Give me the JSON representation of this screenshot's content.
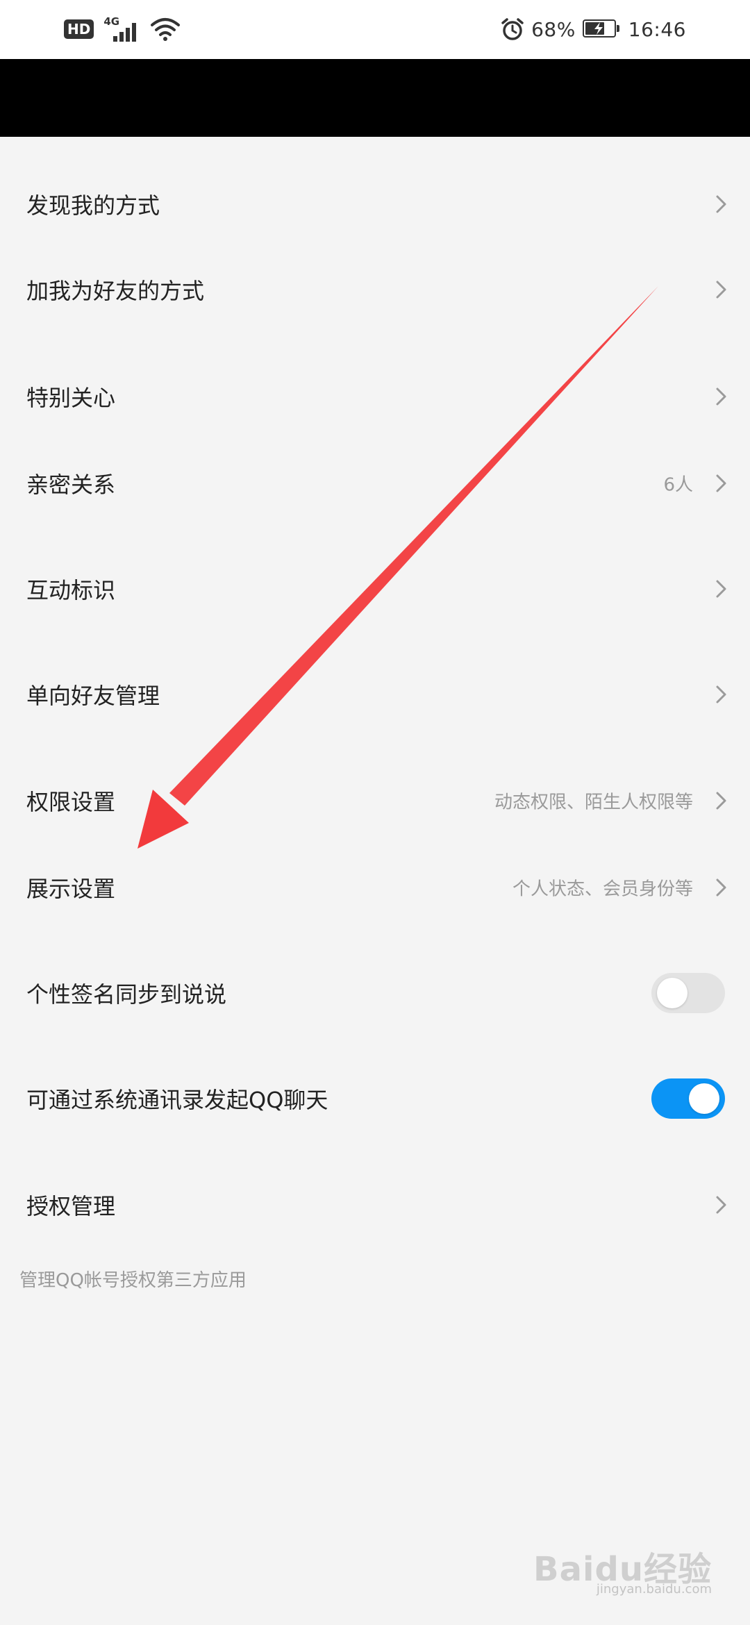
{
  "status_bar": {
    "hd": "HD",
    "network": "4G",
    "battery_percent": "68%",
    "time": "16:46",
    "battery_level": 0.68,
    "icons": [
      "signal-icon",
      "wifi-icon",
      "alarm-icon",
      "battery-charging-icon"
    ]
  },
  "settings": {
    "items": [
      {
        "label": "发现我的方式",
        "value": ""
      },
      {
        "label": "加我为好友的方式",
        "value": ""
      },
      {
        "label": "特别关心",
        "value": ""
      },
      {
        "label": "亲密关系",
        "value": "6人"
      },
      {
        "label": "互动标识",
        "value": ""
      },
      {
        "label": "单向好友管理",
        "value": ""
      },
      {
        "label": "权限设置",
        "value": "动态权限、陌生人权限等"
      },
      {
        "label": "展示设置",
        "value": "个人状态、会员身份等"
      },
      {
        "label": "个性签名同步到说说",
        "toggle": "off"
      },
      {
        "label": "可通过系统通讯录发起QQ聊天",
        "toggle": "on"
      },
      {
        "label": "授权管理",
        "value": ""
      }
    ],
    "footnote": "管理QQ帐号授权第三方应用"
  },
  "colors": {
    "background": "#f4f4f4",
    "toggle_on": "#0b94f5",
    "toggle_off": "#e3e3e3",
    "annotation_arrow": "#f23a3c"
  },
  "watermark": {
    "brand": "Baidu经验",
    "site": "jingyan.baidu.com"
  }
}
